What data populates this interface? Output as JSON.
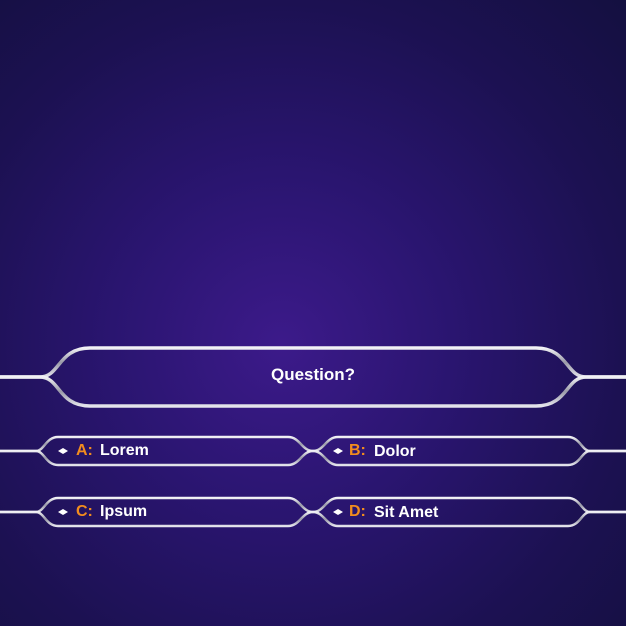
{
  "question": {
    "text": "Question?"
  },
  "answers": [
    {
      "letter": "A:",
      "text": "Lorem"
    },
    {
      "letter": "B:",
      "text": "Dolor"
    },
    {
      "letter": "C:",
      "text": "Ipsum"
    },
    {
      "letter": "D:",
      "text": "Sit Amet"
    }
  ],
  "colors": {
    "background": "#2a1570",
    "frame": "#c8c8d2",
    "letter": "#f28c1e",
    "text": "#ffffff"
  }
}
